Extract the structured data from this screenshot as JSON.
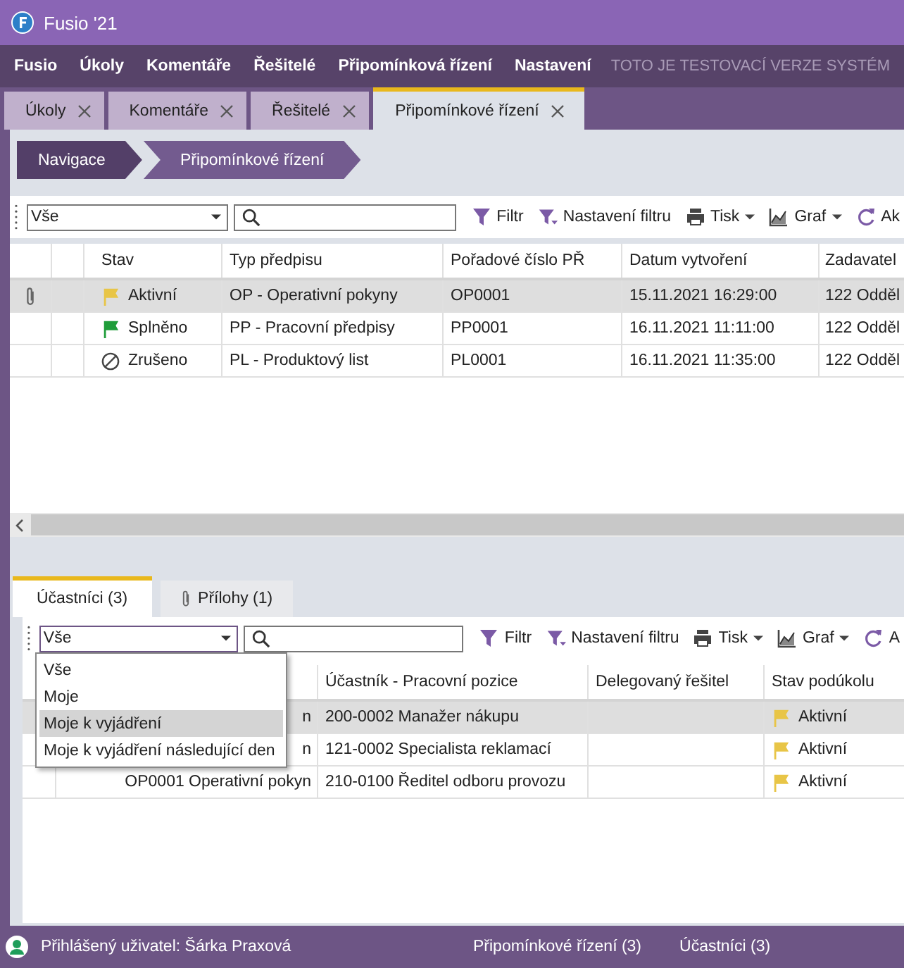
{
  "window": {
    "title": "Fusio '21"
  },
  "menu": {
    "items": [
      "Fusio",
      "Úkoly",
      "Komentáře",
      "Řešitelé",
      "Připomínková řízení",
      "Nastavení"
    ],
    "notice": "TOTO JE TESTOVACÍ VERZE SYSTÉM"
  },
  "tabs": [
    {
      "label": "Úkoly",
      "selected": false
    },
    {
      "label": "Komentáře",
      "selected": false
    },
    {
      "label": "Řešitelé",
      "selected": false
    },
    {
      "label": "Připomínkové řízení",
      "selected": true
    }
  ],
  "breadcrumb": [
    "Navigace",
    "Připomínkové řízení"
  ],
  "toolbar": {
    "filter_value": "Vše",
    "buttons": [
      {
        "kind": "filter",
        "label": "Filtr"
      },
      {
        "kind": "filter-settings",
        "label": "Nastavení filtru"
      },
      {
        "kind": "print",
        "label": "Tisk"
      },
      {
        "kind": "chart",
        "label": "Graf"
      },
      {
        "kind": "refresh",
        "label": "Ak"
      }
    ]
  },
  "table": {
    "columns": [
      "",
      "",
      "Stav",
      "Typ předpisu",
      "Pořadové číslo PŘ",
      "Datum vytvoření",
      "Zadavatel"
    ],
    "rows": [
      {
        "selected": true,
        "attachment": true,
        "kind": "active",
        "status": "Aktivní",
        "type": "OP - Operativní pokyny",
        "number": "OP0001",
        "date": "15.11.2021 16:29:00",
        "author": "122 Odděl"
      },
      {
        "selected": false,
        "attachment": false,
        "kind": "done",
        "status": "Splněno",
        "type": "PP - Pracovní předpisy",
        "number": "PP0001",
        "date": "16.11.2021 11:11:00",
        "author": "122 Odděl"
      },
      {
        "selected": false,
        "attachment": false,
        "kind": "cancelled",
        "status": "Zrušeno",
        "type": "PL - Produktový list",
        "number": "PL0001",
        "date": "16.11.2021 11:35:00",
        "author": "122 Odděl"
      }
    ]
  },
  "sub_tabs": [
    {
      "label": "Účastníci (3)",
      "selected": true,
      "attachment": false
    },
    {
      "label": "Přílohy (1)",
      "selected": false,
      "attachment": true
    }
  ],
  "sub_toolbar": {
    "filter_value": "Vše",
    "buttons": [
      {
        "kind": "filter",
        "label": "Filtr"
      },
      {
        "kind": "filter-settings",
        "label": "Nastavení filtru"
      },
      {
        "kind": "print",
        "label": "Tisk"
      },
      {
        "kind": "chart",
        "label": "Graf"
      },
      {
        "kind": "refresh",
        "label": "A"
      }
    ]
  },
  "dropdown": {
    "items": [
      {
        "label": "Vše",
        "highlighted": false
      },
      {
        "label": "Moje",
        "highlighted": false
      },
      {
        "label": "Moje k vyjádření",
        "highlighted": true
      },
      {
        "label": "Moje k vyjádření následující den",
        "highlighted": false
      }
    ]
  },
  "sub_table": {
    "columns": [
      "",
      "",
      "Účastník - Pracovní pozice",
      "Delegovaný řešitel",
      "Stav podúkolu"
    ],
    "rows": [
      {
        "selected": true,
        "column_1": "n",
        "participant": "200-0002 Manažer nákupu",
        "kind": "active",
        "status": "Aktivní"
      },
      {
        "selected": false,
        "column_1": "n",
        "participant": "121-0002 Specialista reklamací",
        "kind": "active",
        "status": "Aktivní"
      },
      {
        "selected": false,
        "column_1": "OP0001 Operativní pokyn",
        "participant": "210-0100 Ředitel odboru provozu",
        "kind": "active",
        "status": "Aktivní"
      }
    ]
  },
  "status_bar": {
    "user": "Přihlášený uživatel: Šárka Praxová",
    "items": [
      "Připomínkové řízení (3)",
      "Účastníci (3)"
    ]
  }
}
